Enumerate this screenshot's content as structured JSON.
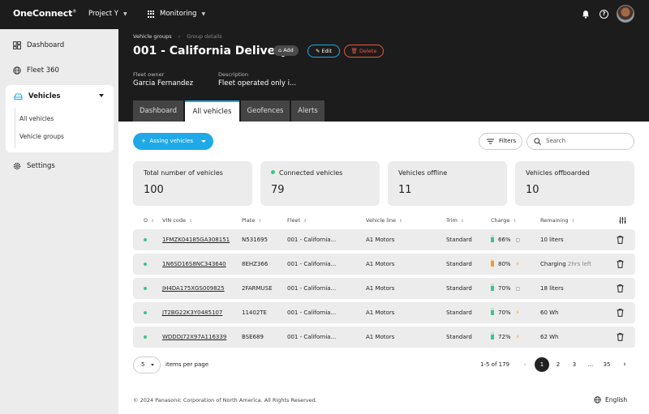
{
  "topbar": {
    "logo": "OneConnect",
    "logo_tm": "®",
    "project": "Project Y",
    "module": "Monitoring"
  },
  "sidebar": {
    "items": [
      {
        "label": "Dashboard",
        "icon": "dashboard-icon"
      },
      {
        "label": "Fleet 360",
        "icon": "globe-icon"
      },
      {
        "label": "Vehicles",
        "icon": "car-icon"
      },
      {
        "label": "Settings",
        "icon": "gear-icon"
      }
    ],
    "vehicles_sub": [
      "All vehicles",
      "Vehicle groups"
    ],
    "collapse_icon": "collapse-sidebar-icon"
  },
  "header": {
    "breadcrumb": [
      "Vehicle groups",
      "Group details"
    ],
    "title": "001 - California Delivery",
    "add_label": "Add",
    "edit_label": "Edit",
    "delete_label": "Delete",
    "fleet_owner_label": "Fleet owner",
    "fleet_owner": "Garcia Fernandez",
    "description_label": "Description",
    "description": "Fleet operated only i...",
    "tabs": [
      "Dashboard",
      "All vehicles",
      "Geofences",
      "Alerts"
    ],
    "active_tab": "All vehicles"
  },
  "toolbar": {
    "assign_label": "Assing vehicles",
    "filters_label": "Filters",
    "search_placeholder": "Search"
  },
  "stats": [
    {
      "label": "Total number of vehicles",
      "value": "100"
    },
    {
      "label": "Connected vehicles",
      "value": "79"
    },
    {
      "label": "Vehicles offline",
      "value": "11"
    },
    {
      "label": "Vehicles offboarded",
      "value": "10"
    }
  ],
  "table": {
    "columns": [
      "O",
      "VIN code",
      "Plate",
      "Fleet",
      "Vehicle line",
      "Trim",
      "Charge",
      "Remaining"
    ],
    "rows": [
      {
        "vin": "1FMZK04185GA308151",
        "plate": "N531695",
        "fleet": "001 - California...",
        "line": "A1 Motors",
        "trim": "Standard",
        "charge": "66%",
        "battery_level": 0.66,
        "state": "plug",
        "remaining": "10 liters",
        "remaining_extra": ""
      },
      {
        "vin": "1N6SD16S8NC343640",
        "plate": "8EHZ366",
        "fleet": "001 - California...",
        "line": "A1 Motors",
        "trim": "Standard",
        "charge": "80%",
        "battery_level": 0.8,
        "state": "charging",
        "remaining": "Charging",
        "remaining_extra": "2hrs left"
      },
      {
        "vin": "JH4DA175XGS009825",
        "plate": "2FARMUSE",
        "fleet": "001 - California...",
        "line": "A1 Motors",
        "trim": "Standard",
        "charge": "70%",
        "battery_level": 0.7,
        "state": "plug",
        "remaining": "18 liters",
        "remaining_extra": ""
      },
      {
        "vin": "JT2BG22K3Y0485107",
        "plate": "11402TE",
        "fleet": "001 - California...",
        "line": "A1 Motors",
        "trim": "Standard",
        "charge": "70%",
        "battery_level": 0.7,
        "state": "charging",
        "remaining": "60 Wh",
        "remaining_extra": ""
      },
      {
        "vin": "WDDDJ72X97A116339",
        "plate": "BSE689",
        "fleet": "001 - California...",
        "line": "A1 Motors",
        "trim": "Standard",
        "charge": "72%",
        "battery_level": 0.72,
        "state": "charging",
        "remaining": "62 Wh",
        "remaining_extra": ""
      }
    ]
  },
  "pagination": {
    "per_page": "5",
    "per_page_label": "items per page",
    "range": "1-5 of 179",
    "pages": [
      "1",
      "2",
      "3",
      "...",
      "35"
    ],
    "current": "1"
  },
  "footer": {
    "copyright": "© 2024 Panasonic Corporation of North America. All Rights Reserved.",
    "language": "English"
  },
  "colors": {
    "accent": "#1fa9e8",
    "danger": "#e8583a",
    "online": "#3cc48a",
    "battery_green": "#3cc48a",
    "battery_orange": "#f0a020"
  }
}
